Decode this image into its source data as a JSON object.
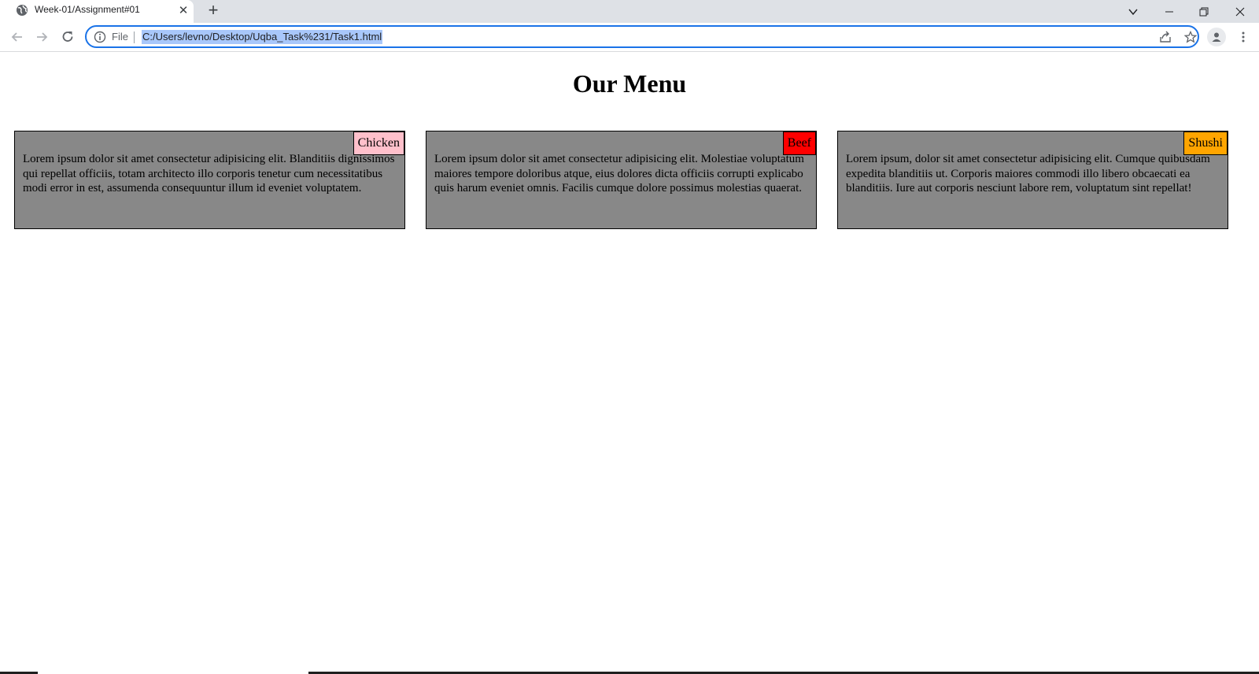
{
  "browser": {
    "tab": {
      "title": "Week-01/Assignment#01",
      "close_glyph": "✕",
      "favicon": "globe-icon"
    },
    "new_tab_glyph": "+",
    "address_bar": {
      "scheme_label": "File",
      "url": "C:/Users/levno/Desktop/Uqba_Task%231/Task1.html",
      "selected": true
    },
    "icons": [
      "back-arrow-icon",
      "forward-arrow-icon",
      "reload-icon",
      "info-icon",
      "share-icon",
      "star-icon",
      "profile-icon",
      "kebab-menu-icon",
      "tab-search-icon",
      "minimize-icon",
      "restore-icon",
      "close-icon"
    ]
  },
  "page": {
    "title": "Our Menu",
    "cards": [
      {
        "tag": "Chicken",
        "tag_color": "#ffc0cb",
        "text": "Lorem ipsum dolor sit amet consectetur adipisicing elit. Blanditiis dignissimos qui repellat officiis, totam architecto illo corporis tenetur cum necessitatibus modi error in est, assumenda consequuntur illum id eveniet voluptatem."
      },
      {
        "tag": "Beef",
        "tag_color": "#ff0000",
        "text": "Lorem ipsum dolor sit amet consectetur adipisicing elit. Molestiae voluptatum maiores tempore doloribus atque, eius dolores dicta officiis corrupti explicabo quis harum eveniet omnis. Facilis cumque dolore possimus molestias quaerat."
      },
      {
        "tag": "Shushi",
        "tag_color": "#ffa500",
        "text": "Lorem ipsum, dolor sit amet consectetur adipisicing elit. Cumque quibusdam expedita blanditiis ut. Corporis maiores commodi illo libero obcaecati ea blanditiis. Iure aut corporis nesciunt labore rem, voluptatum sint repellat!"
      }
    ],
    "card_background": "#888888"
  },
  "colors": {
    "tabbar": "#dee1e6",
    "focus_ring": "#1a73e8",
    "selection": "#a8c7fa"
  }
}
